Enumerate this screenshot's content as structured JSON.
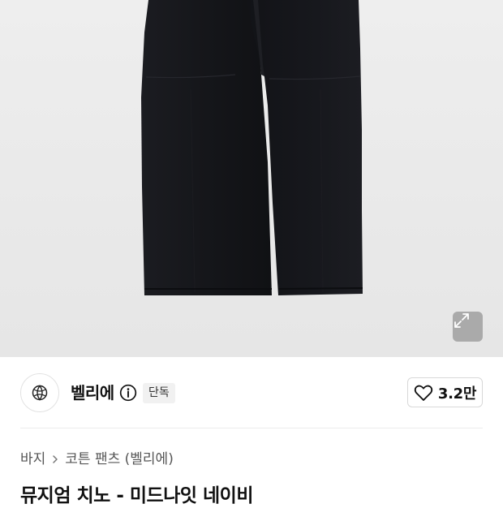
{
  "gallery": {
    "image_subject": "navy-chino-pants",
    "expand_icon": "expand-icon"
  },
  "brand": {
    "logo_icon": "brand-logo-icon",
    "name": "벨리에",
    "info_icon": "info-icon",
    "badge": "단독"
  },
  "like": {
    "icon": "heart-icon",
    "count": "3.2만"
  },
  "breadcrumb": {
    "items": [
      "바지",
      "코튼 팬츠 (벨리에)"
    ],
    "separator_icon": "chevron-right-icon"
  },
  "product": {
    "title": "뮤지엄 치노 - 미드나잇 네이비"
  },
  "colors": {
    "pants": "#15161a",
    "hero_bg": "#ececec",
    "text": "#111111"
  }
}
